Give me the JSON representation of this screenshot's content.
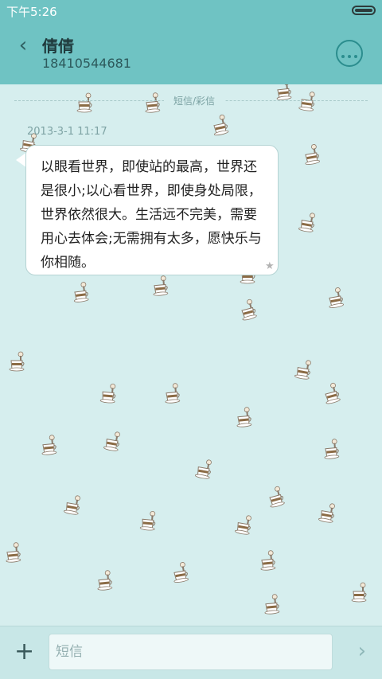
{
  "status_bar": {
    "time": "下午5:26"
  },
  "header": {
    "back_icon": "‹",
    "contact_name": "倩倩",
    "contact_number": "18410544681",
    "more_icon": "more-dots-icon"
  },
  "conversation": {
    "divider_label": "短信/彩信",
    "messages": [
      {
        "timestamp": "2013-3-1 11:17",
        "text": "以眼看世界，即使站的最高，世界还是很小;以心看世界，即使身处局限，世界依然很大。生活远不完美，需要用心去体会;无需拥有太多，愿快乐与你相随。",
        "star_icon": "★"
      }
    ]
  },
  "composer": {
    "add_icon": "+",
    "placeholder": "短信",
    "send_icon": "›"
  },
  "colors": {
    "header_bg": "#6fc3c3",
    "chat_bg": "#d6eeee",
    "bubble_bg": "#ffffff",
    "accent": "#2b8d8e"
  }
}
